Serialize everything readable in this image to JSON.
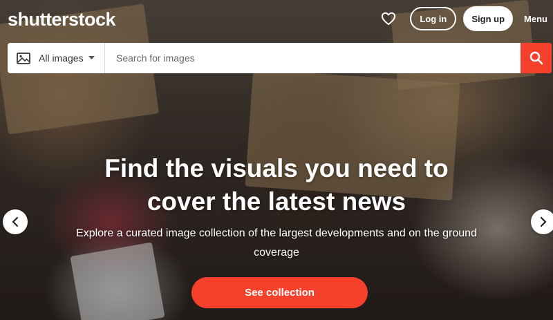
{
  "header": {
    "logo_text": "shutterstock",
    "login_label": "Log in",
    "signup_label": "Sign up",
    "menu_label": "Menu"
  },
  "search": {
    "type_label": "All images",
    "placeholder": "Search for images"
  },
  "hero": {
    "title_line1": "Find the visuals you need to",
    "title_line2": "cover the latest news",
    "subtitle": "Explore a curated image collection of the largest developments and on the ground coverage",
    "cta_label": "See collection"
  },
  "icons": {
    "favorites": "heart-icon",
    "image_type": "image-icon",
    "dropdown": "chevron-down-icon",
    "search": "search-icon",
    "prev": "chevron-left-icon",
    "next": "chevron-right-icon"
  },
  "colors": {
    "accent": "#f5402c",
    "text_light": "#ffffff",
    "search_bg": "#ffffff"
  }
}
